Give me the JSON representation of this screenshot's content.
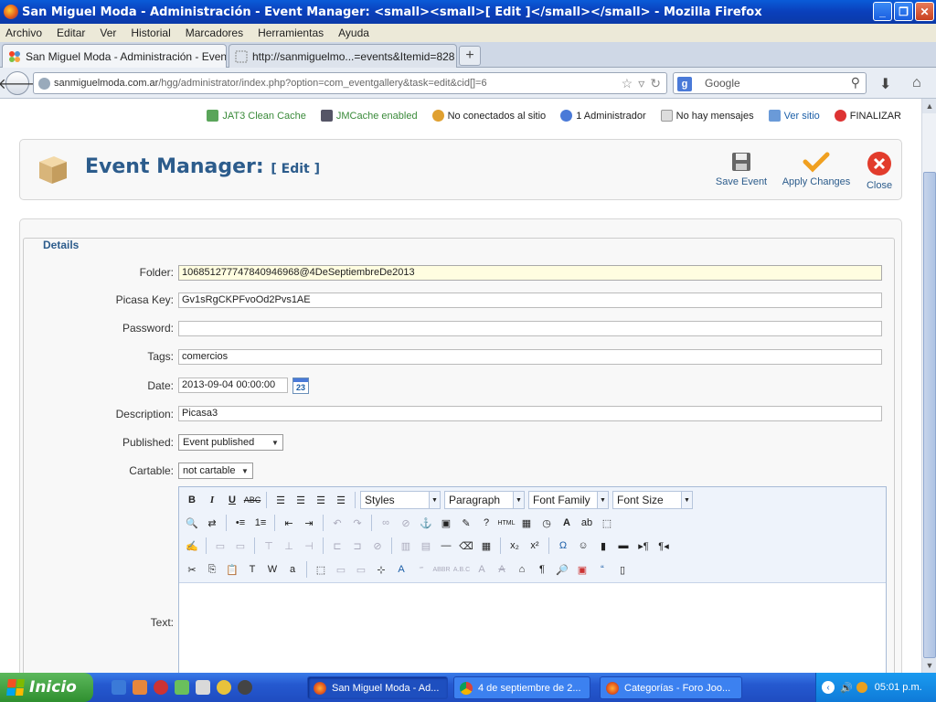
{
  "window": {
    "title": "San Miguel Moda - Administración - Event Manager: <small><small>[ Edit ]</small></small> - Mozilla Firefox"
  },
  "menu": [
    "Archivo",
    "Editar",
    "Ver",
    "Historial",
    "Marcadores",
    "Herramientas",
    "Ayuda"
  ],
  "tabs": [
    {
      "label": "San Miguel Moda - Administración - Event..."
    },
    {
      "label": "http://sanmiguelmo...=events&Itemid=828"
    }
  ],
  "nav": {
    "url_host": "sanmiguelmoda.com.ar",
    "url_path": "/hgg/administrator/index.php?option=com_eventgallery&task=edit&cid[]=6",
    "search_placeholder": "Google"
  },
  "status": [
    {
      "label": "JAT3 Clean Cache",
      "color": "#3a8a3a"
    },
    {
      "label": "JMCache enabled",
      "color": "#3a8a3a"
    },
    {
      "label": "No conectados al sitio",
      "color": "#222222"
    },
    {
      "label": "1 Administrador",
      "color": "#222222"
    },
    {
      "label": "No hay mensajes",
      "color": "#222222"
    },
    {
      "label": "Ver sitio",
      "color": "#1c5fa8"
    },
    {
      "label": "FINALIZAR",
      "color": "#222222"
    }
  ],
  "header": {
    "title": "Event Manager:",
    "subtitle": "[ Edit ]",
    "buttons": {
      "save": "Save Event",
      "apply": "Apply Changes",
      "close": "Close"
    }
  },
  "form": {
    "legend": "Details",
    "folder": {
      "label": "Folder:",
      "value": "106851277747840946968@4DeSeptiembreDe2013"
    },
    "picasa": {
      "label": "Picasa Key:",
      "value": "Gv1sRgCKPFvoOd2Pvs1AE"
    },
    "password": {
      "label": "Password:",
      "value": ""
    },
    "tags": {
      "label": "Tags:",
      "value": "comercios"
    },
    "date": {
      "label": "Date:",
      "value": "2013-09-04 00:00:00"
    },
    "description": {
      "label": "Description:",
      "value": "Picasa3"
    },
    "published": {
      "label": "Published:",
      "value": "Event published"
    },
    "cartable": {
      "label": "Cartable:",
      "value": "not cartable"
    },
    "text": {
      "label": "Text:"
    }
  },
  "editor": {
    "styles": "Styles",
    "paragraph": "Paragraph",
    "font_family": "Font Family",
    "font_size": "Font Size"
  },
  "taskbar": {
    "start": "Inicio",
    "tasks": [
      {
        "label": "San Miguel Moda - Ad..."
      },
      {
        "label": "4 de septiembre de 2..."
      },
      {
        "label": "Categorías - Foro Joo..."
      }
    ],
    "clock": "05:01 p.m."
  }
}
